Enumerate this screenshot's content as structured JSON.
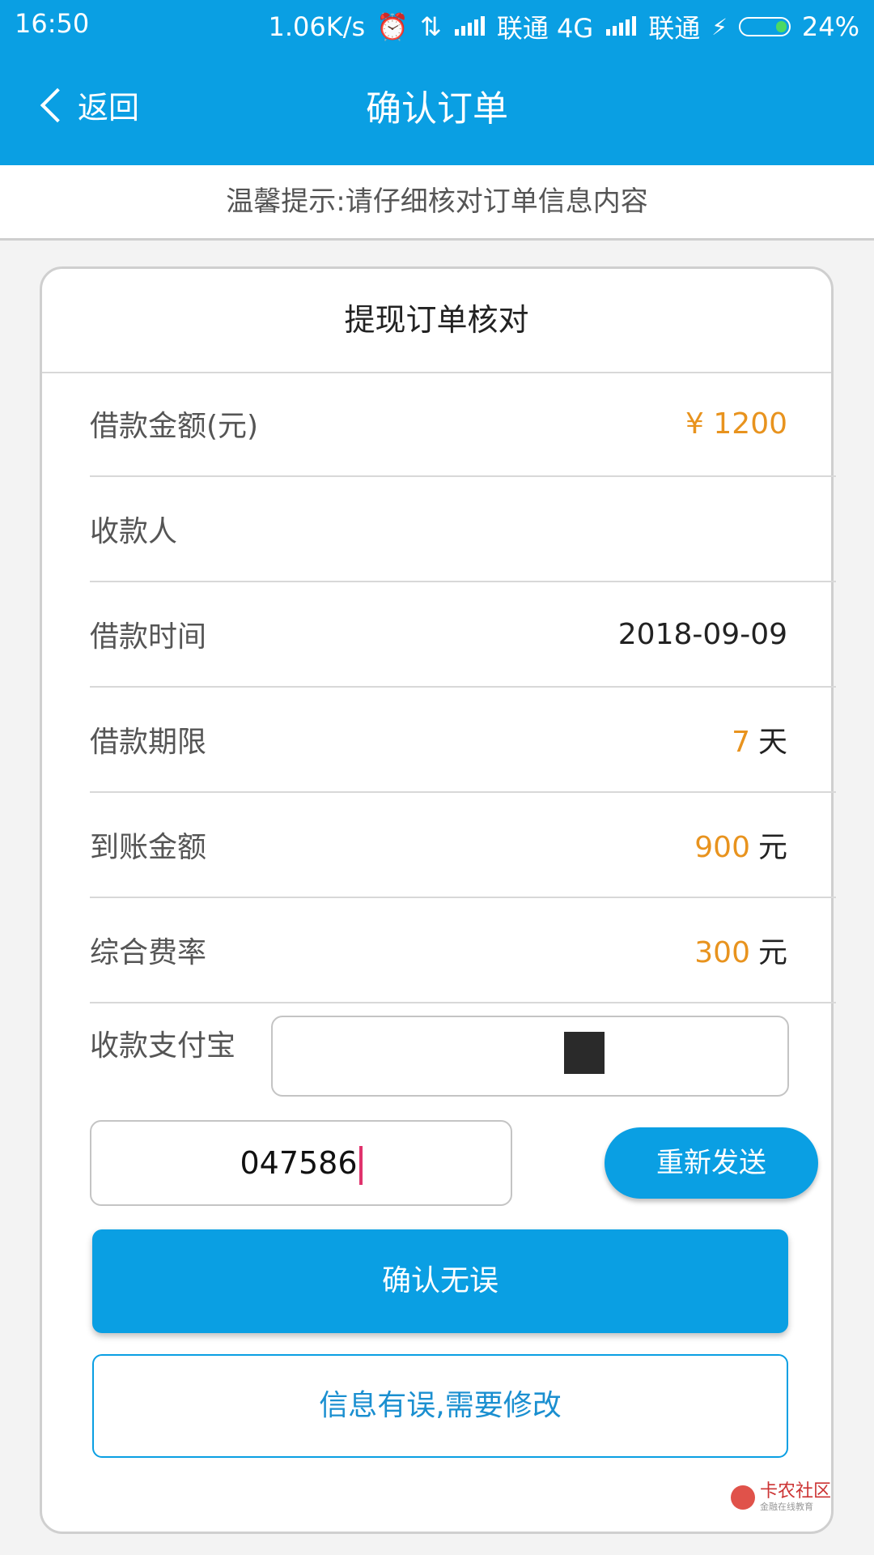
{
  "status_bar": {
    "time": "16:50",
    "speed": "1.06K/s",
    "carrier1": "联通 4G",
    "carrier2": "联通",
    "battery": "24%",
    "battery_level": 0.24
  },
  "nav": {
    "back_label": "返回",
    "title": "确认订单"
  },
  "tip": "温馨提示:请仔细核对订单信息内容",
  "card": {
    "title": "提现订单核对",
    "rows": [
      {
        "label": "借款金额(元)",
        "value": "¥ 1200",
        "unit": ""
      },
      {
        "label": "收款人",
        "value": "",
        "unit": ""
      },
      {
        "label": "借款时间",
        "value": "2018-09-09",
        "unit": ""
      },
      {
        "label": "借款期限",
        "value": "7",
        "unit": "天"
      },
      {
        "label": "到账金额",
        "value": "900",
        "unit": "元"
      },
      {
        "label": "综合费率",
        "value": "300",
        "unit": "元"
      }
    ],
    "alipay_label": "收款支付宝",
    "code_value": "047586",
    "resend_label": "重新发送",
    "confirm_label": "确认无误",
    "modify_label": "信息有误,需要修改"
  },
  "watermark": {
    "main": "卡农社区",
    "sub": "金融在线教育"
  },
  "colors": {
    "primary": "#0a9fe3",
    "accent": "#e8931e"
  }
}
